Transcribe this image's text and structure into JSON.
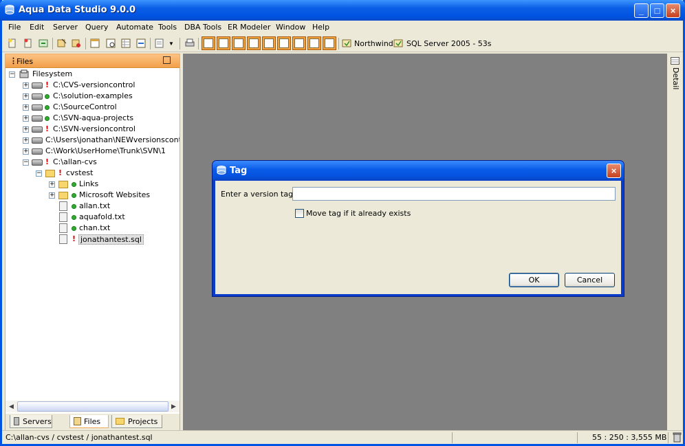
{
  "window": {
    "title": "Aqua Data Studio 9.0.0",
    "minimize": "_",
    "maximize": "□",
    "close": "×"
  },
  "menu": [
    "File",
    "Edit",
    "Server",
    "Query",
    "Automate",
    "Tools",
    "DBA Tools",
    "ER Modeler",
    "Window",
    "Help"
  ],
  "toolbar": {
    "connections": [
      "Northwind",
      "SQL Server 2005 - 53s"
    ]
  },
  "files_panel": {
    "title": "Files",
    "tree": [
      {
        "label": "Filesystem",
        "status": "none",
        "type": "root"
      },
      {
        "label": "C:\\CVS-versioncontrol",
        "status": "modified",
        "type": "drive"
      },
      {
        "label": "C:\\solution-examples",
        "status": "ok",
        "type": "drive"
      },
      {
        "label": "C:\\SourceControl",
        "status": "ok",
        "type": "drive"
      },
      {
        "label": "C:\\SVN-aqua-projects",
        "status": "ok",
        "type": "drive"
      },
      {
        "label": "C:\\SVN-versioncontrol",
        "status": "modified",
        "type": "drive"
      },
      {
        "label": "C:\\Users\\jonathan\\NEWversionscontrol",
        "status": "none",
        "type": "drive"
      },
      {
        "label": "C:\\Work\\UserHome\\Trunk\\SVN\\1",
        "status": "none",
        "type": "drive"
      },
      {
        "label": "C:\\allan-cvs",
        "status": "modified",
        "type": "drive"
      },
      {
        "label": "cvstest",
        "status": "modified",
        "type": "folder-open"
      },
      {
        "label": "Links",
        "status": "ok",
        "type": "folder"
      },
      {
        "label": "Microsoft Websites",
        "status": "ok",
        "type": "folder"
      },
      {
        "label": "allan.txt",
        "status": "ok",
        "type": "file"
      },
      {
        "label": "aquafold.txt",
        "status": "ok",
        "type": "file"
      },
      {
        "label": "chan.txt",
        "status": "ok",
        "type": "file"
      },
      {
        "label": "jonathantest.sql",
        "status": "modified",
        "type": "file",
        "selected": true
      }
    ],
    "tabs": [
      "Servers",
      "Files",
      "Projects"
    ],
    "active_tab": "Files"
  },
  "right_strip": {
    "label": "Detail"
  },
  "status_bar": {
    "path": "C:\\allan-cvs / cvstest / jonathantest.sql",
    "memory": "55 : 250 : 3,555 MB"
  },
  "dialog": {
    "title": "Tag",
    "tag_label": "Enter a version tag:",
    "tag_value": "",
    "checkbox_label": "Move tag if it already exists",
    "checkbox_checked": false,
    "ok_label": "OK",
    "cancel_label": "Cancel"
  }
}
